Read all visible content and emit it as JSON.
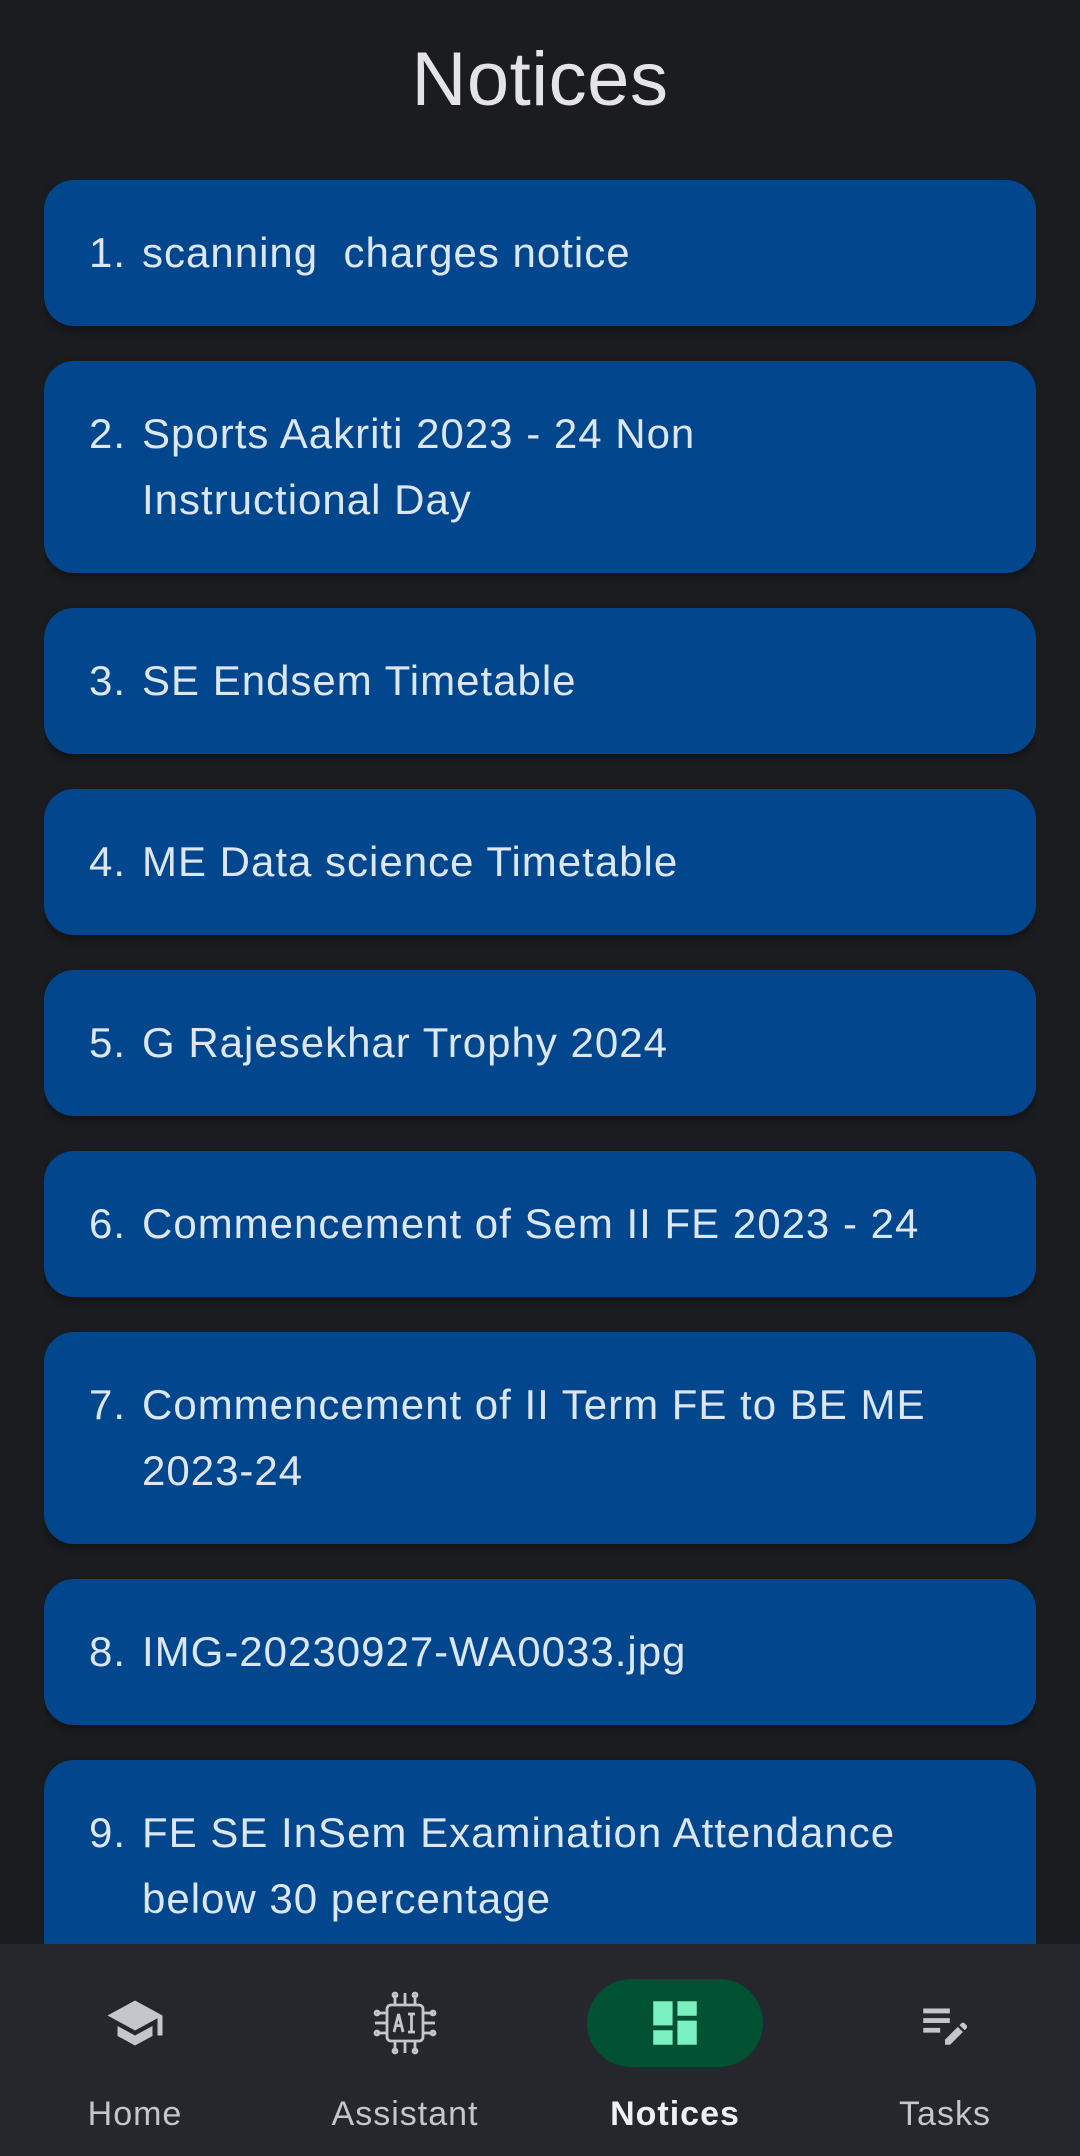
{
  "header": {
    "title": "Notices"
  },
  "notices": [
    {
      "number": "1.",
      "title": "scanning  charges notice"
    },
    {
      "number": "2.",
      "title": "Sports Aakriti 2023 - 24 Non Instructional Day"
    },
    {
      "number": "3.",
      "title": "SE Endsem Timetable"
    },
    {
      "number": "4.",
      "title": "ME Data science Timetable"
    },
    {
      "number": "5.",
      "title": "G Rajesekhar Trophy 2024"
    },
    {
      "number": "6.",
      "title": "Commencement of Sem II FE 2023 - 24"
    },
    {
      "number": "7.",
      "title": "Commencement of II Term FE to BE ME 2023-24"
    },
    {
      "number": "8.",
      "title": "IMG-20230927-WA0033.jpg"
    },
    {
      "number": "9.",
      "title": "FE SE InSem Examination Attendance below 30 percentage"
    }
  ],
  "bottom_nav": {
    "items": [
      {
        "label": "Home",
        "icon": "graduation-cap-icon",
        "active": false
      },
      {
        "label": "Assistant",
        "icon": "ai-chip-icon",
        "active": false
      },
      {
        "label": "Notices",
        "icon": "dashboard-grid-icon",
        "active": true
      },
      {
        "label": "Tasks",
        "icon": "edit-list-icon",
        "active": false
      }
    ]
  },
  "colors": {
    "background": "#1b1c1f",
    "card": "#02478e",
    "nav_background": "#25272d",
    "active_indicator": "#015233",
    "active_icon": "#7af0c0"
  }
}
